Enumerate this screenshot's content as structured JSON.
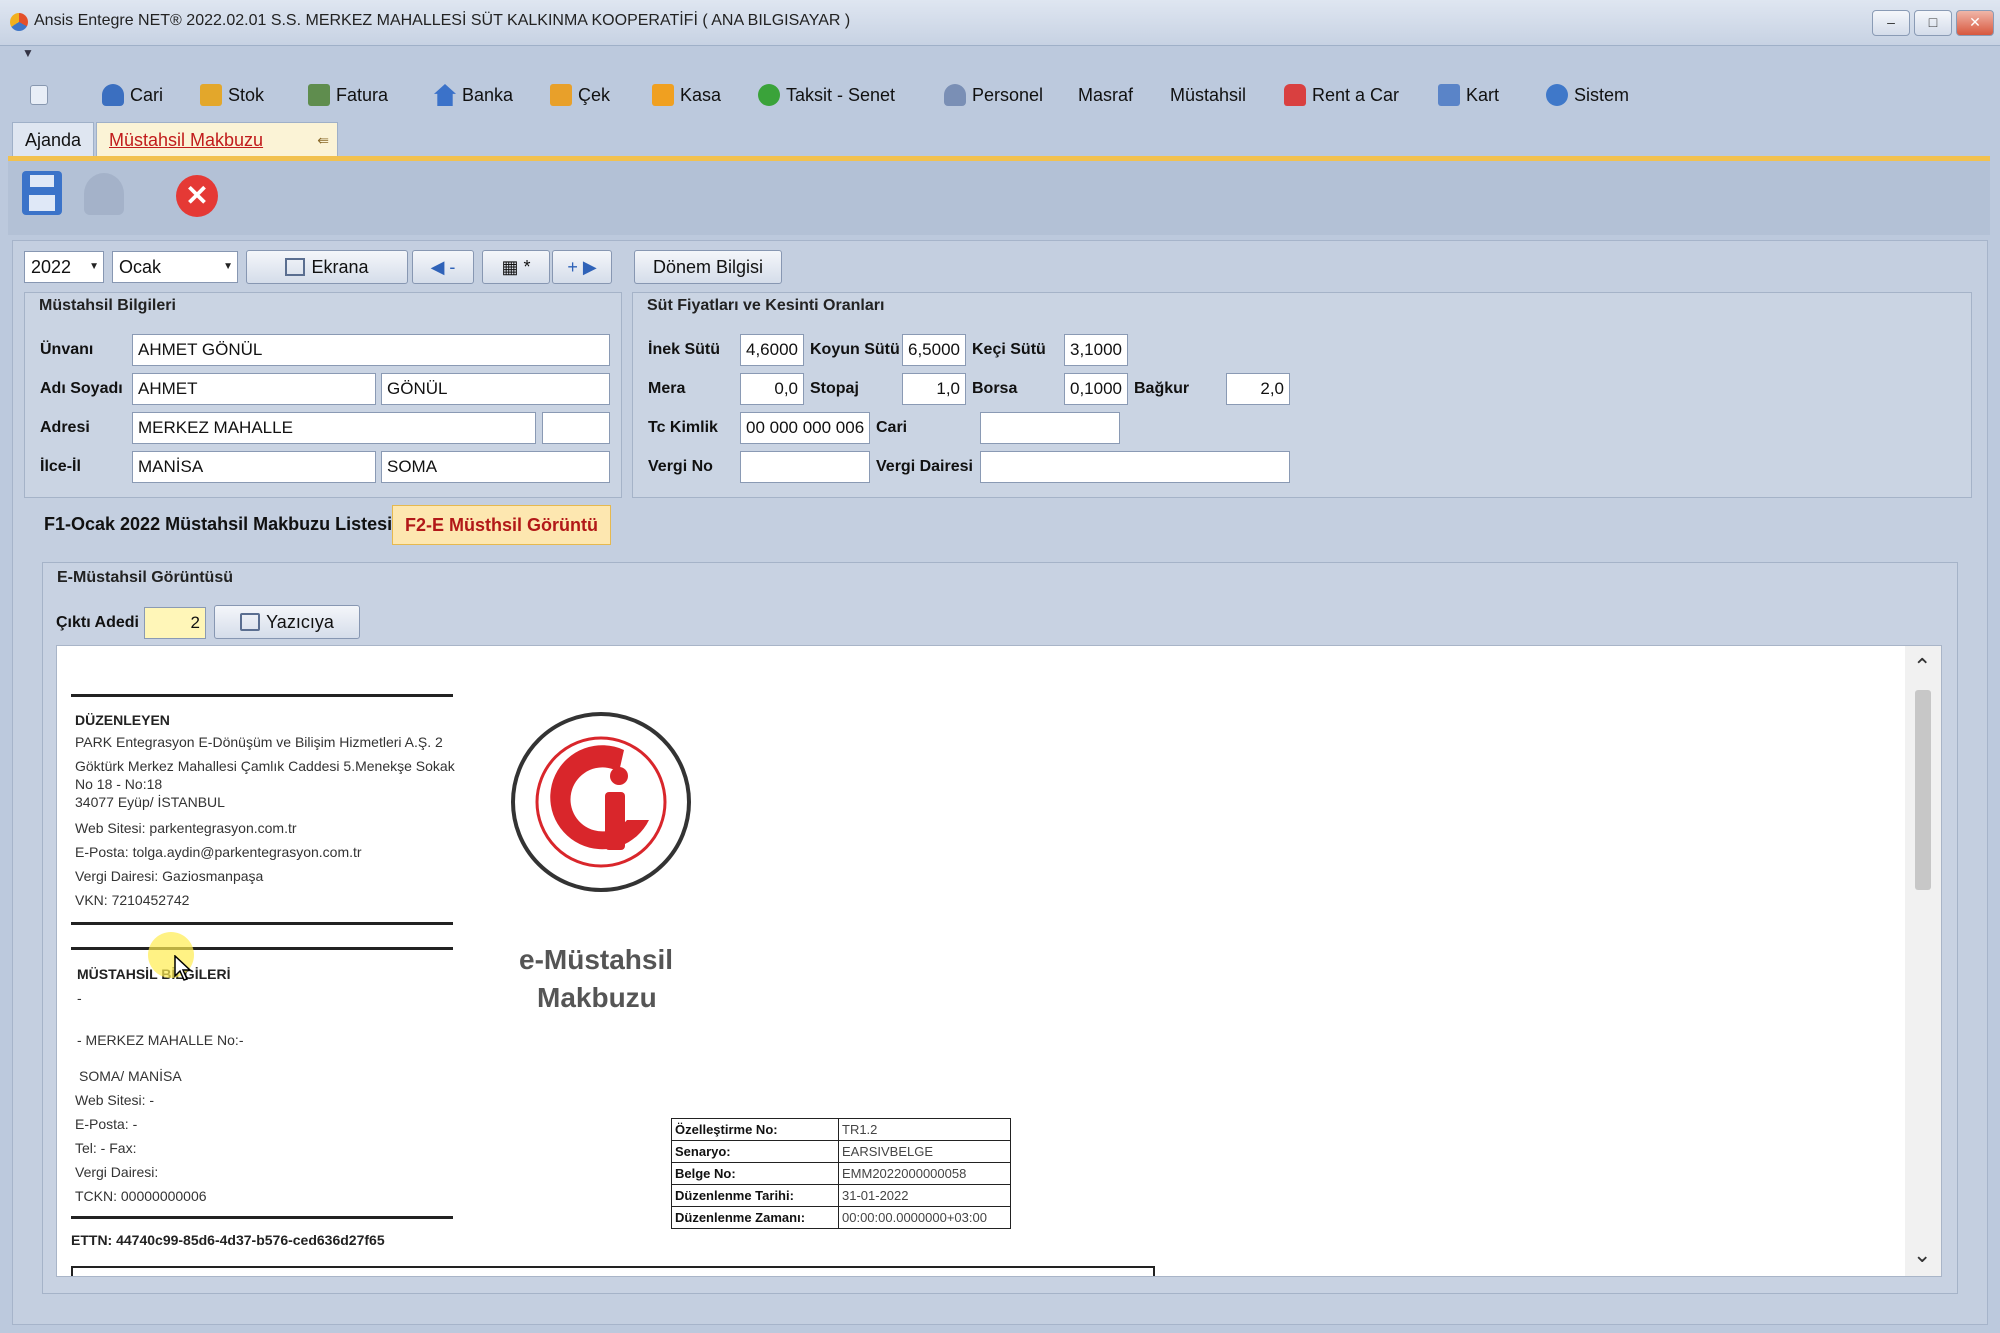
{
  "window": {
    "title": "Ansis Entegre NET® 2022.02.01 S.S. MERKEZ MAHALLESİ SÜT KALKINMA KOOPERATİFİ ( ANA BILGISAYAR )",
    "min": "–",
    "max": "□",
    "close": "✕"
  },
  "menu": {
    "quick": "▼",
    "items": [
      "Cari",
      "Stok",
      "Fatura",
      "Banka",
      "Çek",
      "Kasa",
      "Taksit - Senet",
      "Personel",
      "Masraf",
      "Müstahsil",
      "Rent a Car",
      "Kart",
      "Sistem"
    ]
  },
  "tabs": {
    "ajanda": "Ajanda",
    "active": "Müstahsil Makbuzu",
    "pin": "⇚"
  },
  "toolbar": {
    "year": "2022",
    "month": "Ocak",
    "ekrana": "Ekrana",
    "prev": "◀ -",
    "grid": "▦ *",
    "next": "+ ▶",
    "donem": "Dönem Bilgisi"
  },
  "mustahsil": {
    "title": "Müstahsil Bilgileri",
    "labels": {
      "unvan": "Ünvanı",
      "ad": "Adı Soyadı",
      "adres": "Adresi",
      "ilce": "İlce-İl"
    },
    "unvan": "AHMET GÖNÜL",
    "ad": "AHMET",
    "soyad": "GÖNÜL",
    "adres": "MERKEZ MAHALLE",
    "adres2": "",
    "ilce": "MANİSA",
    "il": "SOMA"
  },
  "sut": {
    "title": "Süt Fiyatları ve Kesinti Oranları",
    "labels": {
      "inek": "İnek Sütü",
      "koyun": "Koyun Sütü",
      "keci": "Keçi Sütü",
      "mera": "Mera",
      "stopaj": "Stopaj",
      "borsa": "Borsa",
      "bagkur": "Bağkur",
      "tc": "Tc Kimlik",
      "cari": "Cari",
      "vergino": "Vergi No",
      "vergidairesi": "Vergi Dairesi"
    },
    "inek": "4,6000",
    "koyun": "6,5000",
    "keci": "3,1000",
    "mera": "0,0",
    "stopaj": "1,0",
    "borsa": "0,1000",
    "bagkur": "2,0",
    "tc": "00 000 000 006",
    "cari": "",
    "vergino": "",
    "vergidairesi": ""
  },
  "subtabs": {
    "list": "F1-Ocak 2022 Müstahsil Makbuzu Listesi",
    "view": "F2-E Müsthsil Görüntü"
  },
  "preview": {
    "title": "E-Müstahsil Görüntüsü",
    "cikti_label": "Çıktı Adedi",
    "cikti_value": "2",
    "yaziciya": "Yazıcıya",
    "scroll_up": "⌃",
    "scroll_down": "⌄"
  },
  "doc": {
    "duzenleyen_title": "DÜZENLEYEN",
    "duzenleyen_lines": [
      "PARK Entegrasyon E-Dönüşüm ve Bilişim Hizmetleri A.Ş. 2",
      "Göktürk Merkez Mahallesi Çamlık Caddesi 5.Menekşe Sokak",
      "No 18  - No:18",
      "34077 Eyüp/ İSTANBUL",
      "Web Sitesi: parkentegrasyon.com.tr",
      "E-Posta: tolga.aydin@parkentegrasyon.com.tr",
      "Vergi Dairesi: Gaziosmanpaşa",
      "VKN: 7210452742"
    ],
    "mustahsil_title": "MÜSTAHSİL BİLGİLERİ",
    "mustahsil_lines": [
      "-",
      "- MERKEZ MAHALLE No:-",
      "SOMA/ MANİSA",
      "Web Sitesi: -",
      "E-Posta: -",
      "Tel: - Fax:",
      "Vergi Dairesi:",
      "TCKN: 00000000006"
    ],
    "ettn": "ETTN: 44740c99-85d6-4d37-b576-ced636d27f65",
    "logo_title_1": "e-Müstahsil",
    "logo_title_2": "Makbuzu",
    "info": [
      {
        "k": "Özelleştirme No:",
        "v": "TR1.2"
      },
      {
        "k": "Senaryo:",
        "v": "EARSIVBELGE"
      },
      {
        "k": "Belge No:",
        "v": "EMM2022000000058"
      },
      {
        "k": "Düzenlenme Tarihi:",
        "v": "31-01-2022"
      },
      {
        "k": "Düzenlenme Zamanı:",
        "v": "00:00:00.0000000+03:00"
      }
    ],
    "colors": {
      "logo_red": "#d9262b",
      "accent": "#f2c14e"
    }
  }
}
